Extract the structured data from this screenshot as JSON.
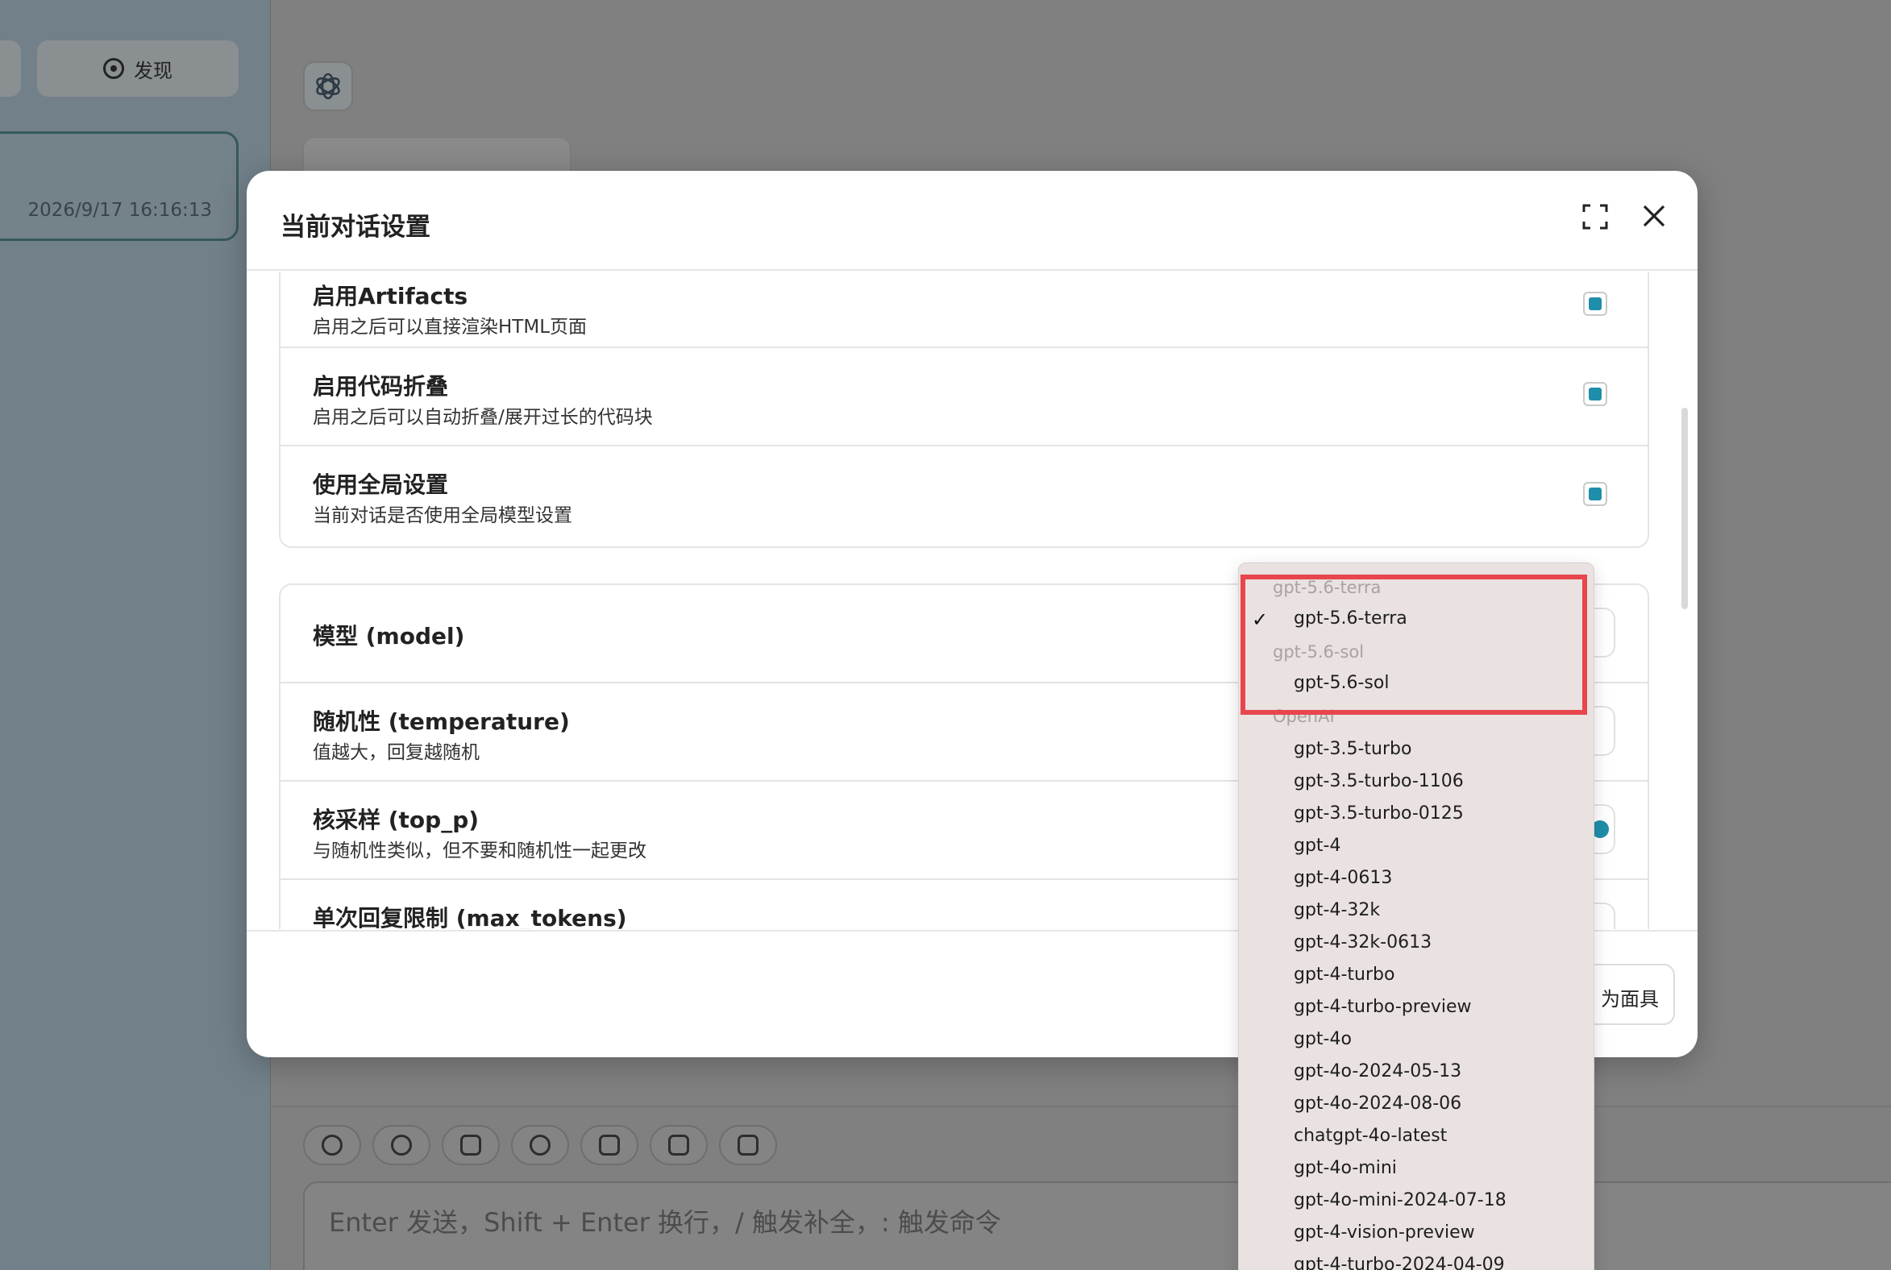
{
  "sidebar": {
    "discover_label": "发现",
    "chat_time": "2026/9/17 16:16:13"
  },
  "modal": {
    "title": "当前对话设置",
    "toggles": [
      {
        "title": "启用Artifacts",
        "subtitle": "启用之后可以直接渲染HTML页面",
        "checked": true
      },
      {
        "title": "启用代码折叠",
        "subtitle": "启用之后可以自动折叠/展开过长的代码块",
        "checked": true
      },
      {
        "title": "使用全局设置",
        "subtitle": "当前对话是否使用全局模型设置",
        "checked": true
      }
    ],
    "params": [
      {
        "title": "模型 (model)",
        "subtitle": ""
      },
      {
        "title": "随机性 (temperature)",
        "subtitle": "值越大，回复越随机"
      },
      {
        "title": "核采样 (top_p)",
        "subtitle": "与随机性类似，但不要和随机性一起更改"
      },
      {
        "title": "单次回复限制 (max_tokens)",
        "subtitle": ""
      }
    ],
    "footer_button_label": "为面具"
  },
  "dropdown": {
    "group_terra": "gpt-5.6-terra",
    "item_terra": "gpt-5.6-terra",
    "group_sol": "gpt-5.6-sol",
    "item_sol": "gpt-5.6-sol",
    "group_openai": "OpenAI",
    "selected": "gpt-5.6-terra",
    "items": [
      "gpt-3.5-turbo",
      "gpt-3.5-turbo-1106",
      "gpt-3.5-turbo-0125",
      "gpt-4",
      "gpt-4-0613",
      "gpt-4-32k",
      "gpt-4-32k-0613",
      "gpt-4-turbo",
      "gpt-4-turbo-preview",
      "gpt-4o",
      "gpt-4o-2024-05-13",
      "gpt-4o-2024-08-06",
      "chatgpt-4o-latest",
      "gpt-4o-mini",
      "gpt-4o-mini-2024-07-18",
      "gpt-4-vision-preview",
      "gpt-4-turbo-2024-04-09"
    ]
  },
  "chat": {
    "input_placeholder": "Enter 发送，Shift + Enter 换行，/ 触发补全，: 触发命令"
  },
  "colors": {
    "accent": "#1f8eaa",
    "highlight": "#e8454c"
  }
}
